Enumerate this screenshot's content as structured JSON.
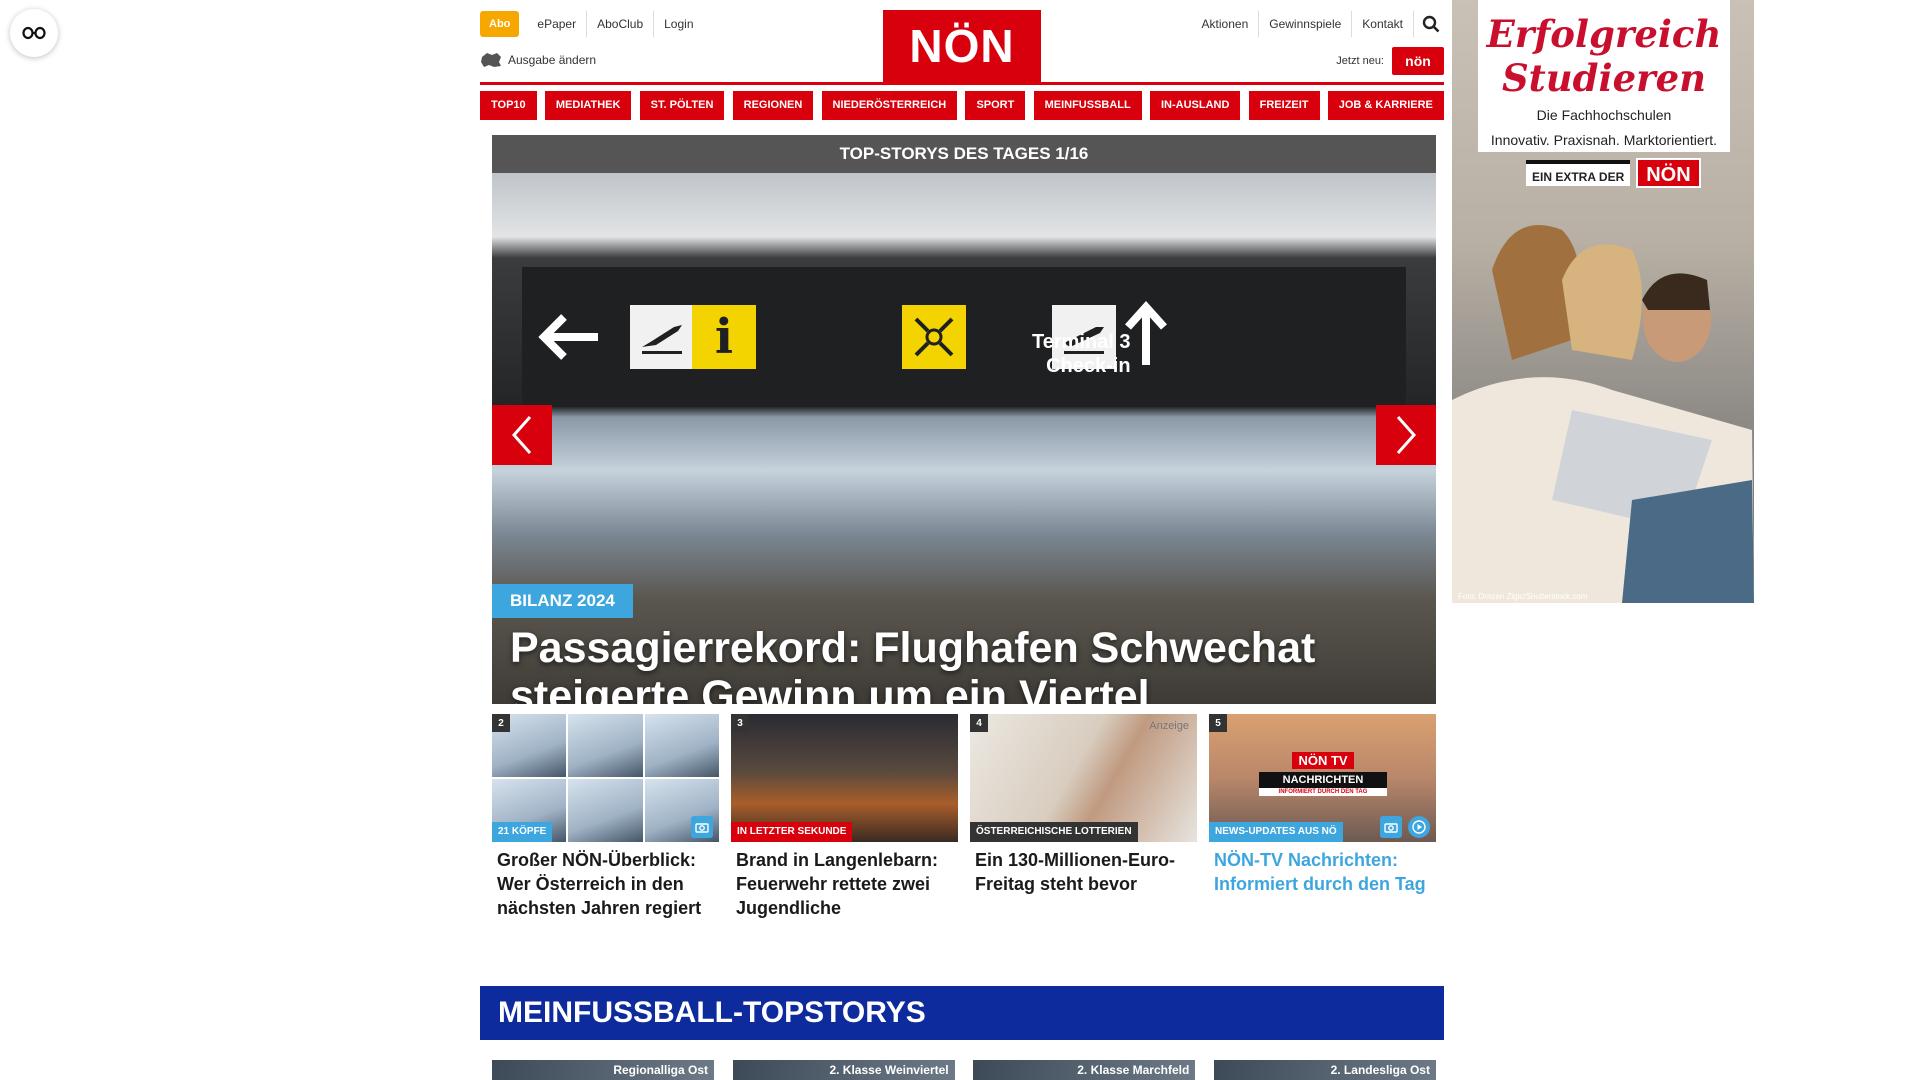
{
  "header": {
    "abo": "Abo",
    "top_links": [
      "ePaper",
      "AboClub",
      "Login"
    ],
    "ausgabe": "Ausgabe ändern",
    "logo": "NÖN",
    "right_links": [
      "Aktionen",
      "Gewinnspiele",
      "Kontakt"
    ],
    "jetzt_neu": "Jetzt neu:",
    "jetzt_badge": "nön"
  },
  "nav": [
    "TOP10",
    "MEDIATHEK",
    "ST. PÖLTEN",
    "REGIONEN",
    "NIEDERÖSTERREICH",
    "SPORT",
    "MEINFUSSBALL",
    "IN-AUSLAND",
    "FREIZEIT",
    "JOB & KARRIERE"
  ],
  "hero": {
    "bar_title": "TOP-STORYS DES TAGES 1/16",
    "badge": "BILANZ 2024",
    "headline": "Passagierrekord: Flughafen Schwechat steigerte Gewinn um ein Viertel",
    "sign_text_1": "Terminal 3",
    "sign_text_2": "Check-in",
    "accent": "#d8000c"
  },
  "cards": [
    {
      "num": "2",
      "tag": "21 KÖPFE",
      "tag_color": "#3ea6df",
      "title": "Großer NÖN-Überblick: Wer Österreich in den nächsten Jahren regiert"
    },
    {
      "num": "3",
      "tag": "IN LETZTER SEKUNDE",
      "tag_color": "#d8000c",
      "title": "Brand in Langenlebarn: Feuerwehr rettete zwei Jugendliche"
    },
    {
      "num": "4",
      "tag": "ÖSTERREICHISCHE LOTTERIEN",
      "tag_color": "#333333",
      "anzeige": "Anzeige",
      "title": "Ein 130-Millionen-Euro-Freitag steht bevor"
    },
    {
      "num": "5",
      "tag": "NEWS-UPDATES AUS NÖ",
      "tag_color": "#3ea6df",
      "title": "NÖN-TV Nachrichten: Informiert durch den Tag",
      "tv_logo": "NÖN TV",
      "tv_label": "NACHRICHTEN",
      "tv_sub": "INFORMIERT DURCH DEN TAG"
    }
  ],
  "meinfussball": {
    "title": "MEINFUSSBALL-TOPSTORYS",
    "labels": [
      "Regionalliga Ost",
      "2. Klasse Weinviertel",
      "2. Klasse Marchfeld",
      "2. Landesliga Ost"
    ]
  },
  "ad": {
    "title_1": "Erfolgreich",
    "title_2": "Studieren",
    "sub_1": "Die Fachhochschulen",
    "sub_2": "Innovativ. Praxisnah. Marktorientiert.",
    "extra": "EIN EXTRA DER",
    "extra_logo": "NÖN",
    "credit": "Foto: Drazen Zigic/Shutterstock.com"
  }
}
